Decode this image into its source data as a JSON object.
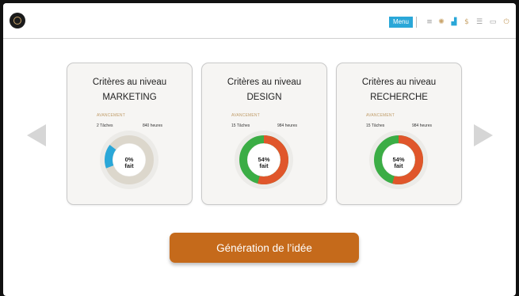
{
  "toolbar": {
    "menu_label": "Menu",
    "icons": [
      {
        "name": "list-icon",
        "glyph": "≡",
        "color": "#9a9a9a"
      },
      {
        "name": "sun-icon",
        "glyph": "✺",
        "color": "#c9a46b"
      },
      {
        "name": "bar-chart-icon",
        "glyph": "▟",
        "color": "#2aa7d8"
      },
      {
        "name": "dollar-icon",
        "glyph": "$",
        "color": "#c9a46b"
      },
      {
        "name": "align-icon",
        "glyph": "☰",
        "color": "#9a9a9a"
      },
      {
        "name": "battery-icon",
        "glyph": "▭",
        "color": "#9a9a9a"
      },
      {
        "name": "power-icon",
        "glyph": "⏻",
        "color": "#c9a46b"
      }
    ]
  },
  "cards": [
    {
      "title_line1": "Critères au niveau",
      "title_line2": "MARKETING",
      "progress_label": "AVANCEMENT",
      "tasks": "2 Tâches",
      "hours": "840 heures",
      "percent": "0%",
      "percent_suffix": "fait",
      "progress": 0,
      "progress_color": "#2aa7d8",
      "track_color": "#dcd7cc"
    },
    {
      "title_line1": "Critères au niveau",
      "title_line2": "DESIGN",
      "progress_label": "AVANCEMENT",
      "tasks": "15 Tâches",
      "hours": "984 heures",
      "percent": "54%",
      "percent_suffix": "fait",
      "progress": 0.54,
      "progress_color": "#e0562b",
      "track_color": "#3bad45"
    },
    {
      "title_line1": "Critères au niveau",
      "title_line2": "RECHERCHE",
      "progress_label": "AVANCEMENT",
      "tasks": "15 Tâches",
      "hours": "984 heures",
      "percent": "54%",
      "percent_suffix": "fait",
      "progress": 0.54,
      "progress_color": "#e0562b",
      "track_color": "#3bad45"
    }
  ],
  "cta_label": "Génération de l’idée"
}
